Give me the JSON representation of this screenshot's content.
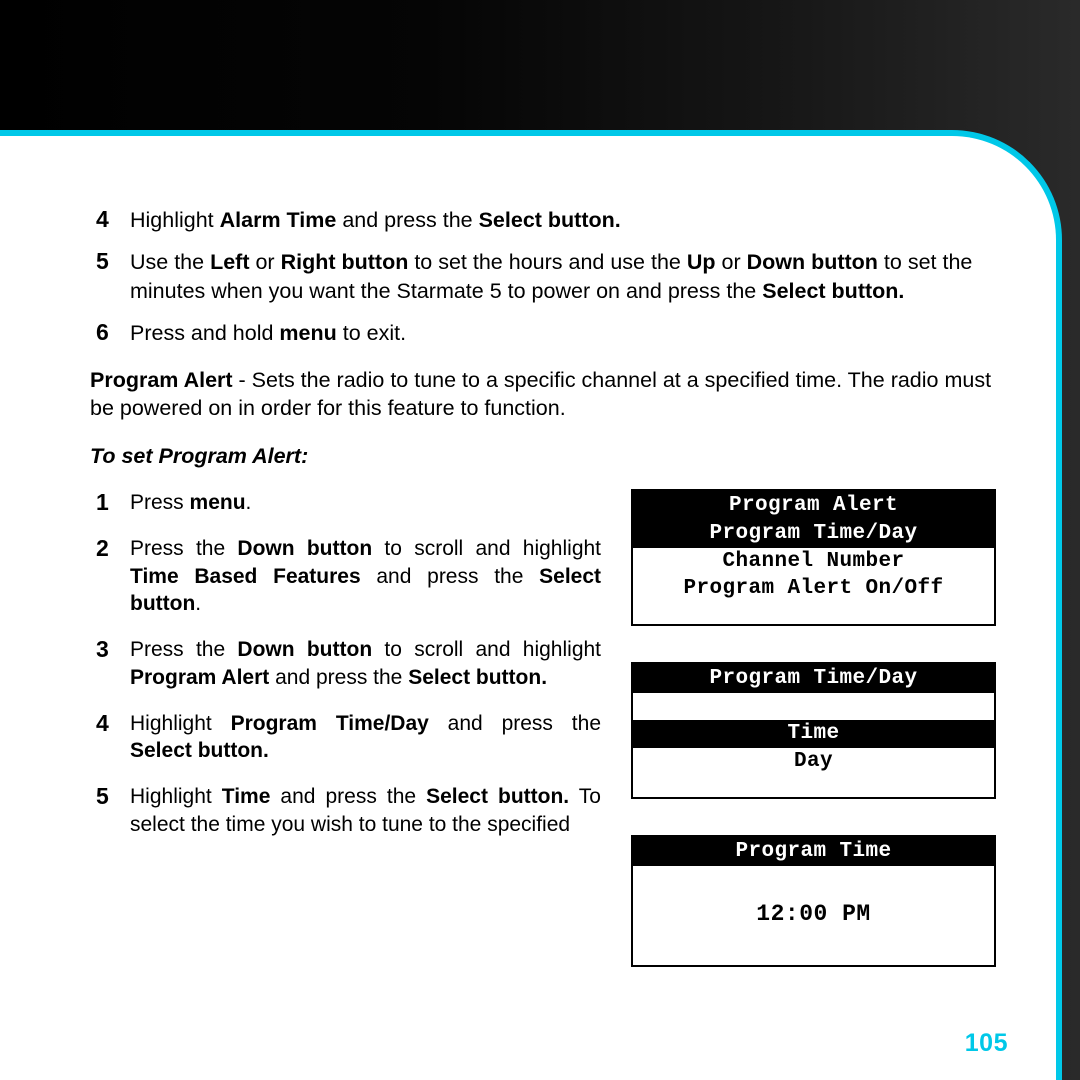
{
  "topsteps": [
    {
      "num": "4",
      "html": "Highlight <b>Alarm Time</b> and press the <b>Select button.</b>"
    },
    {
      "num": "5",
      "html": "Use the <b>Left</b> or <b>Right button</b> to set the hours and use the <b>Up</b> or <b>Down button</b> to set the minutes when you want the Starmate 5 to power on and press the <b>Select button.</b>"
    },
    {
      "num": "6",
      "html": "Press and hold <b>menu</b> to exit."
    }
  ],
  "para_html": "<b>Program Alert</b> - Sets the radio to tune to a specific channel at a specified time. The radio must be powered on in order for this feature to function.",
  "subhead": "To set Program Alert:",
  "leftsteps": [
    {
      "num": "1",
      "html": "Press <b>menu</b>."
    },
    {
      "num": "2",
      "html": "Press the <b>Down button</b> to scroll and highlight <b>Time Based Features</b> and press the <b>Select button</b>."
    },
    {
      "num": "3",
      "html": "Press the <b>Down button</b> to scroll and highlight <b>Program Alert</b> and press the <b>Select button.</b>"
    },
    {
      "num": "4",
      "html": "Highlight <b>Program Time/Day</b> and press the <b>Select button.</b>"
    },
    {
      "num": "5",
      "html": "Highlight <b>Time</b> and press the <b>Select button.</b> To select the time you wish to tune to the specified"
    }
  ],
  "lcd1": {
    "title": "Program Alert",
    "rows": [
      {
        "text": "Program Time/Day",
        "sel": true
      },
      {
        "text": "Channel Number",
        "sel": false
      },
      {
        "text": "Program Alert On/Off",
        "sel": false
      }
    ]
  },
  "lcd2": {
    "title": "Program Time/Day",
    "rows": [
      {
        "text": "Time",
        "sel": true
      },
      {
        "text": "Day",
        "sel": false
      }
    ]
  },
  "lcd3": {
    "title": "Program Time",
    "time": "12:00 PM"
  },
  "pagenum": "105"
}
